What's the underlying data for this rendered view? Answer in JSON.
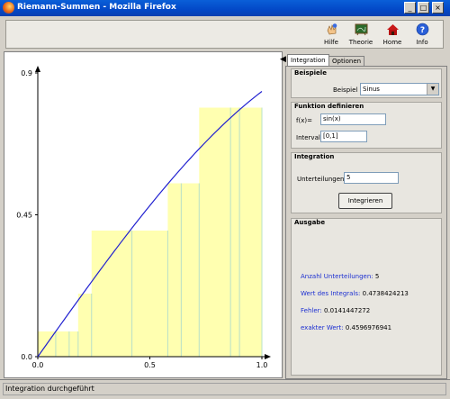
{
  "window": {
    "title": "Riemann-Summen - Mozilla Firefox"
  },
  "toolbar": {
    "items": [
      {
        "label": "Hilfe",
        "icon": "help-hand-icon"
      },
      {
        "label": "Theorie",
        "icon": "blackboard-icon"
      },
      {
        "label": "Home",
        "icon": "house-icon"
      },
      {
        "label": "Info",
        "icon": "info-question-icon"
      }
    ]
  },
  "tabs": [
    {
      "label": "Integration",
      "active": true
    },
    {
      "label": "Optionen",
      "active": false
    }
  ],
  "beispiele": {
    "title": "Beispiele",
    "label": "Beispiel",
    "value": "Sinus"
  },
  "funktion": {
    "title": "Funktion definieren",
    "fx_label": "f(x)=",
    "fx_value": "sin(x)",
    "interval_label": "Intervall",
    "interval_value": "[0,1]"
  },
  "integration": {
    "title": "Integration",
    "label": "Unterteilungen",
    "value": "5",
    "button": "Integrieren"
  },
  "ausgabe": {
    "title": "Ausgabe",
    "lines": [
      {
        "key": "Anzahl Unterteilungen:",
        "value": "5"
      },
      {
        "key": "Wert des Integrals:",
        "value": "0.4738424213"
      },
      {
        "key": "Fehler:",
        "value": "0.0141447272"
      },
      {
        "key": "exakter Wert:",
        "value": "0.4596976941"
      }
    ]
  },
  "status": {
    "text": "Integration durchgeführt"
  },
  "colors": {
    "bar_fill": "#ffffb0",
    "curve": "#2020d0",
    "link": "#1c2fd1"
  },
  "chart_data": {
    "type": "bar",
    "function": "sin(x)",
    "xlim": [
      0,
      1
    ],
    "ylim": [
      0,
      0.9
    ],
    "xticks": [
      "0.0",
      "0.5",
      "1.0"
    ],
    "yticks": [
      "0.0",
      "0.45",
      "0.9"
    ],
    "bars": [
      {
        "x0": 0.0,
        "x1": 0.08,
        "height": 0.08
      },
      {
        "x0": 0.08,
        "x1": 0.18,
        "height": 0.08
      },
      {
        "x0": 0.18,
        "x1": 0.24,
        "height": 0.2
      },
      {
        "x0": 0.24,
        "x1": 0.42,
        "height": 0.4
      },
      {
        "x0": 0.42,
        "x1": 0.58,
        "height": 0.4
      },
      {
        "x0": 0.58,
        "x1": 0.72,
        "height": 0.55
      },
      {
        "x0": 0.72,
        "x1": 0.9,
        "height": 0.79
      },
      {
        "x0": 0.9,
        "x1": 1.0,
        "height": 0.79
      }
    ],
    "dividers": [
      0.08,
      0.14,
      0.18,
      0.24,
      0.42,
      0.58,
      0.64,
      0.72,
      0.86,
      0.9,
      1.0
    ]
  }
}
